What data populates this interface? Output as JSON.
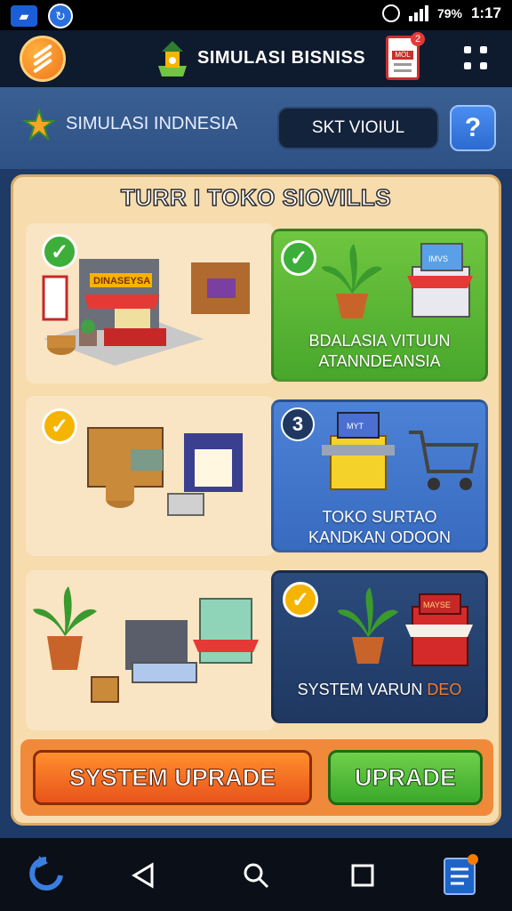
{
  "status_bar": {
    "battery": "79%",
    "time": "1:17"
  },
  "header": {
    "title": "SIMULASI BISNISS",
    "receipt_badge": "2",
    "receipt_label": "MOL"
  },
  "sub_bar": {
    "title": "SIMULASI INDNESIA",
    "button_label": "SKT VIOIUL",
    "help_icon": "?"
  },
  "panel": {
    "title": "TURR I TOKO SIOVILLS",
    "rows": [
      {
        "scene_store_sign": "DINASEYSA",
        "card_text_line1": "BDALASIA VITUUN",
        "card_text_line2": "ATANNDEANSIA",
        "card_sign": "IMVS"
      },
      {
        "card_number": "3",
        "card_text_line1": "TOKO SURTAO",
        "card_text_line2": "KANDKAN ODOON",
        "card_sign": "MYT"
      },
      {
        "card_text_main": "SYSTEM VARUN",
        "card_text_highlight": "DEO",
        "card_sign": "MAYSE"
      }
    ]
  },
  "buttons": {
    "system_upgrade": "SYSTEM UPRADE",
    "upgrade": "UPRADE"
  },
  "colors": {
    "header_bg": "#0e1a2e",
    "panel_bg": "#f7dcae",
    "card_green": "#48a72c",
    "card_blue": "#386bbf",
    "card_navy": "#1f3862",
    "button_orange": "#e8531a",
    "button_green": "#3ba82a"
  }
}
